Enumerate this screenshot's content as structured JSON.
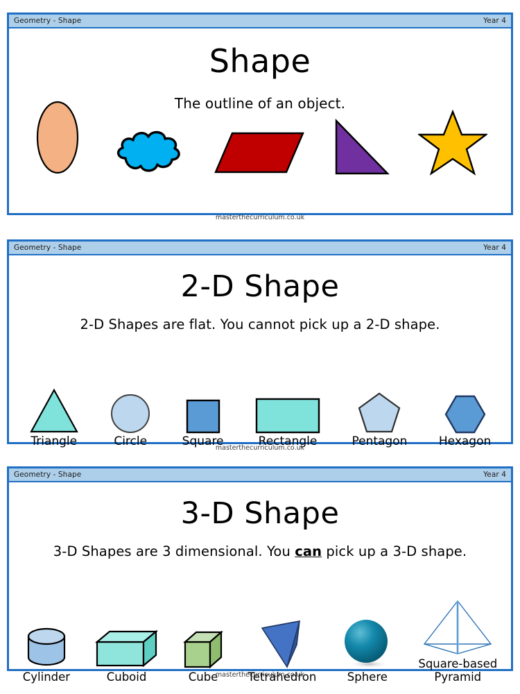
{
  "panels": [
    {
      "header_left": "Geometry - Shape",
      "header_right": "Year 4",
      "title": "Shape",
      "subtitle": "The outline of an object.",
      "watermark": "masterthecurriculum.co.uk",
      "shapes": [
        {
          "name": "ellipse",
          "label": "",
          "fill": "#F4B183",
          "stroke": "#000000"
        },
        {
          "name": "cloud",
          "label": "",
          "fill": "#00B0F0",
          "stroke": "#000000"
        },
        {
          "name": "parallelogram",
          "label": "",
          "fill": "#C00000",
          "stroke": "#000000"
        },
        {
          "name": "right-triangle",
          "label": "",
          "fill": "#7030A0",
          "stroke": "#000000"
        },
        {
          "name": "star",
          "label": "",
          "fill": "#FFC000",
          "stroke": "#000000"
        }
      ]
    },
    {
      "header_left": "Geometry - Shape",
      "header_right": "Year 4",
      "title": "2-D Shape",
      "subtitle": "2-D Shapes are flat. You cannot pick up a 2-D shape.",
      "watermark": "masterthecurriculum.co.uk",
      "shapes": [
        {
          "name": "triangle",
          "label": "Triangle",
          "fill": "#7FE3DC",
          "stroke": "#000000"
        },
        {
          "name": "circle",
          "label": "Circle",
          "fill": "#BDD7EE",
          "stroke": "#3F3F3F"
        },
        {
          "name": "square",
          "label": "Square",
          "fill": "#5B9BD5",
          "stroke": "#000000"
        },
        {
          "name": "rectangle",
          "label": "Rectangle",
          "fill": "#7FE3DC",
          "stroke": "#000000"
        },
        {
          "name": "pentagon",
          "label": "Pentagon",
          "fill": "#BDD7EE",
          "stroke": "#2F2F2F"
        },
        {
          "name": "hexagon",
          "label": "Hexagon",
          "fill": "#5B9BD5",
          "stroke": "#1F3864"
        }
      ]
    },
    {
      "header_left": "Geometry - Shape",
      "header_right": "Year 4",
      "title": "3-D Shape",
      "subtitle_before": "3-D Shapes are 3 dimensional. You ",
      "subtitle_emphasis": "can",
      "subtitle_after": " pick up a 3-D shape.",
      "watermark": "masterthecurriculum.co.uk",
      "shapes": [
        {
          "name": "cylinder",
          "label": "Cylinder",
          "fill": "#9DC3E6",
          "stroke": "#000000"
        },
        {
          "name": "cuboid",
          "label": "Cuboid",
          "fill": "#8FE5DC",
          "stroke": "#000000"
        },
        {
          "name": "cube",
          "label": "Cube",
          "fill": "#A9D18E",
          "stroke": "#000000"
        },
        {
          "name": "tetrahedron",
          "label": "Tetrahedron",
          "fill": "#4472C4",
          "stroke": "#203864"
        },
        {
          "name": "sphere",
          "label": "Sphere",
          "fill": "#0E7B9B",
          "stroke": "#0A5A72"
        },
        {
          "name": "pyramid",
          "label": "Square-based\nPyramid",
          "fill": "none",
          "stroke": "#2E75B6"
        }
      ]
    }
  ],
  "colors": {
    "panel_border": "#1F6FC4",
    "header_bg": "#AECFEA",
    "text": "#000000"
  }
}
